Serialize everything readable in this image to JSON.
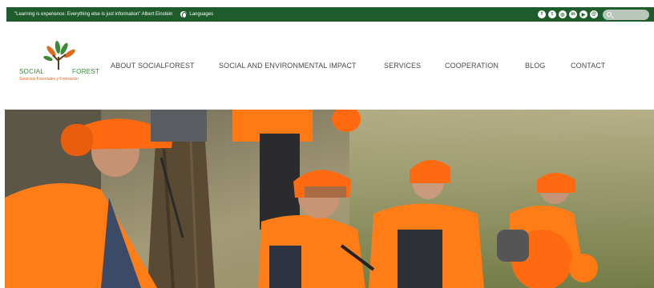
{
  "topbar": {
    "quote": "\"Learning is experience. Everything else is just information\" Albert Einstein",
    "languages_label": "Languages",
    "social_icons": [
      "facebook-icon",
      "twitter-icon",
      "instagram-icon",
      "linkedin-icon",
      "youtube-icon",
      "email-icon"
    ],
    "search_placeholder": ""
  },
  "logo": {
    "social": "SOCIAL",
    "forest": "FOREST",
    "tagline": "Servicios Forestales y Formación"
  },
  "nav": {
    "items": [
      "ABOUT SOCIALFOREST",
      "SOCIAL AND ENVIRONMENTAL IMPACT",
      "SERVICES",
      "COOPERATION",
      "BLOG",
      "CONTACT"
    ]
  },
  "colors": {
    "topbar_bg": "#1f5c2c",
    "brand_green": "#3a8a3a",
    "brand_orange": "#e06a1c",
    "safety_orange": "#ff7a14"
  }
}
